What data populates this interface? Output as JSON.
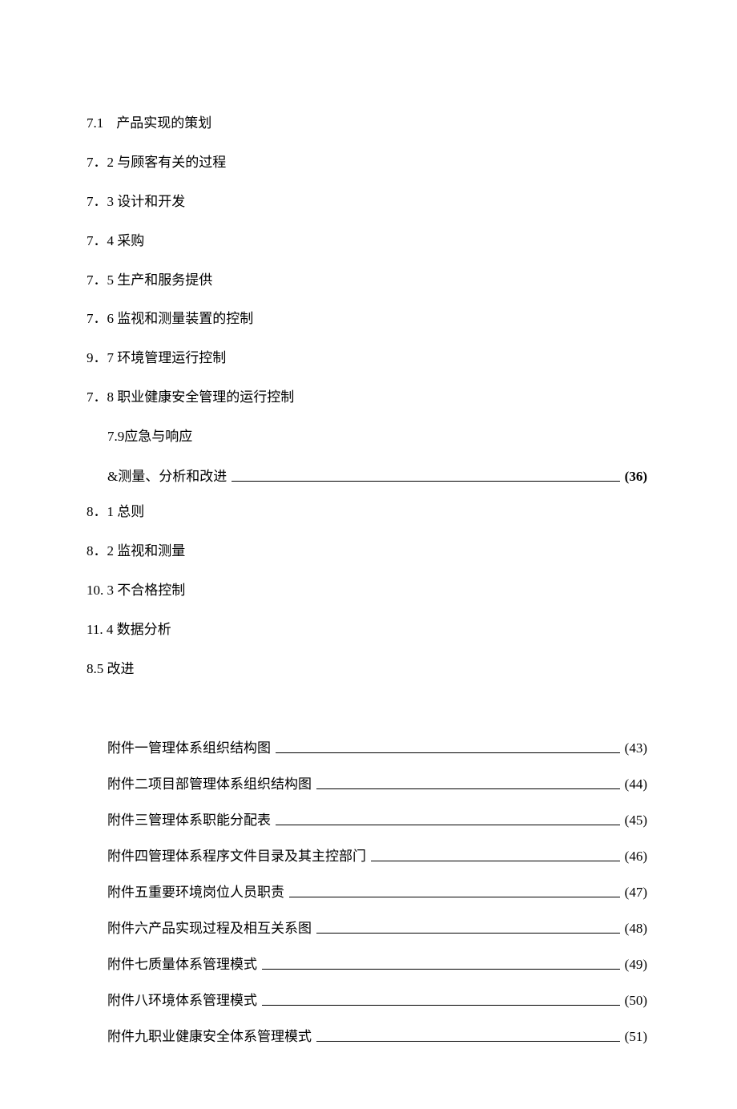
{
  "section1": [
    {
      "num": "7.1",
      "gap": true,
      "title": "产品实现的策划"
    },
    {
      "num": "7．2",
      "title": "与顾客有关的过程"
    },
    {
      "num": "7．3",
      "title": "设计和开发"
    },
    {
      "num": "7．4",
      "title": "采购"
    },
    {
      "num": "7．5",
      "title": "生产和服务提供"
    },
    {
      "num": "7．6",
      "title": "监视和测量装置的控制"
    },
    {
      "num": "9．7",
      "title": "环境管理运行控制"
    },
    {
      "num": "7．8",
      "title": "职业健康安全管理的运行控制"
    }
  ],
  "section1_indent": {
    "text": "7.9应急与响应"
  },
  "section1_heading": {
    "text": "&测量、分析和改进",
    "page": "(36)",
    "bold": true
  },
  "section2": [
    {
      "num": "8．1",
      "title": "总则"
    },
    {
      "num": "8．2",
      "title": "监视和测量"
    },
    {
      "num": "10. 3",
      "title": "不合格控制"
    },
    {
      "num": "11. 4",
      "title": "数据分析"
    },
    {
      "num": "8.5",
      "title": "改进",
      "nospace": true
    }
  ],
  "appendix": [
    {
      "text": "附件一管理体系组织结构图",
      "page": "(43)"
    },
    {
      "text": "附件二项目部管理体系组织结构图",
      "page": "(44)"
    },
    {
      "text": "附件三管理体系职能分配表",
      "page": "(45)"
    },
    {
      "text": "附件四管理体系程序文件目录及其主控部门",
      "page": "(46)"
    },
    {
      "text": "附件五重要环境岗位人员职责",
      "page": "(47)"
    },
    {
      "text": "附件六产品实现过程及相互关系图",
      "page": "(48)"
    },
    {
      "text": "附件七质量体系管理模式",
      "page": "(49)"
    },
    {
      "text": "附件八环境体系管理模式",
      "page": "(50)"
    },
    {
      "text": "附件九职业健康安全体系管理模式",
      "page": "(51)"
    }
  ]
}
